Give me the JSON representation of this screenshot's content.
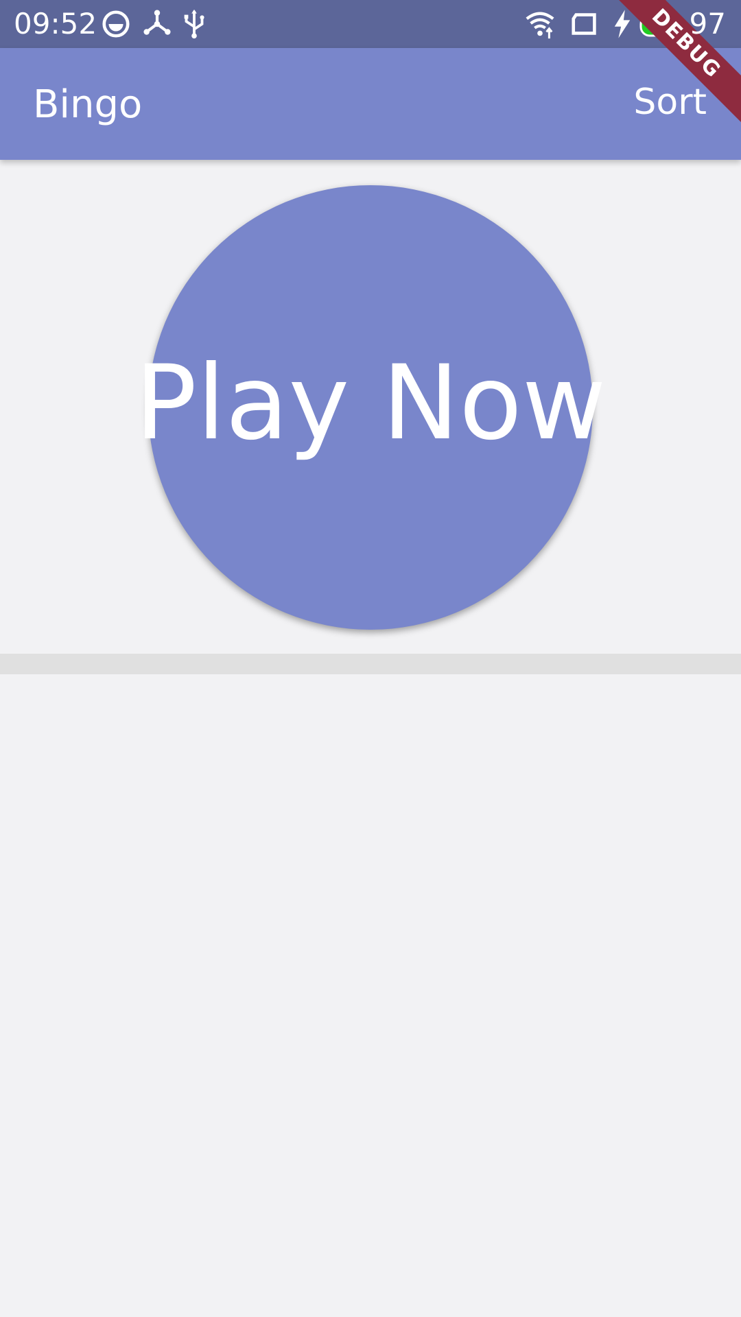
{
  "status_bar": {
    "time": "09:52",
    "battery_level": "97",
    "icons": [
      "face-icon",
      "hub-icon",
      "usb-icon",
      "wifi-icon",
      "sim-icon",
      "charging-icon",
      "battery-icon"
    ],
    "battery_color": "#22cc22"
  },
  "app_bar": {
    "title": "Bingo",
    "sort_label": "Sort",
    "color": "#7986cb"
  },
  "debug_banner": {
    "label": "DEBUG",
    "color": "#8e2b3f"
  },
  "play": {
    "label": "Play Now",
    "color": "#7986cb"
  }
}
